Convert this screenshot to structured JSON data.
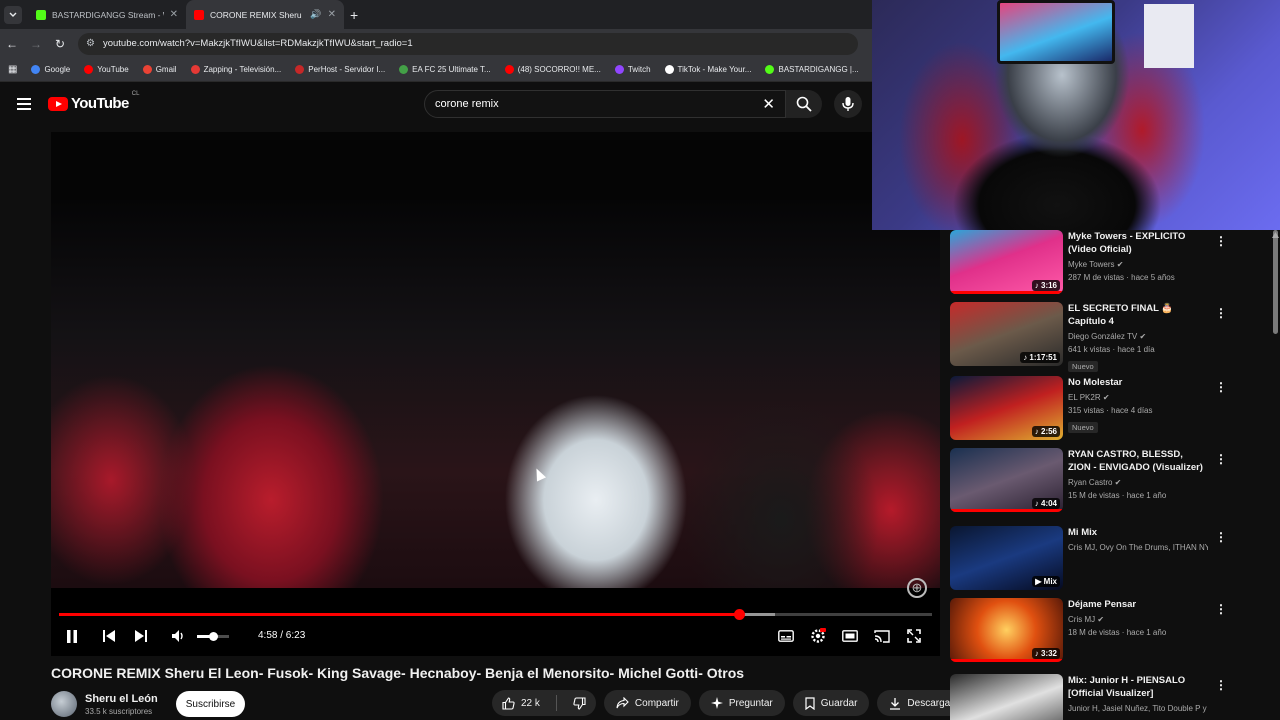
{
  "browser": {
    "tabs": [
      {
        "title": "BASTARDIGANGG Stream - Watch",
        "fav_color": "#53fc18",
        "active": false
      },
      {
        "title": "CORONE REMIX Sheru El Leon",
        "fav_color": "#ff0000",
        "active": true
      }
    ],
    "new_tab": "+",
    "url": "youtube.com/watch?v=MakzjkTfIWU&list=RDMakzjkTfIWU&start_radio=1",
    "bookmarks": [
      {
        "label": "Google",
        "color": "#4285f4"
      },
      {
        "label": "YouTube",
        "color": "#ff0000"
      },
      {
        "label": "Gmail",
        "color": "#ea4335"
      },
      {
        "label": "Zapping - Televisión...",
        "color": "#e53935"
      },
      {
        "label": "PerHost - Servidor I...",
        "color": "#c62828"
      },
      {
        "label": "EA FC 25 Ultimate T...",
        "color": "#43a047"
      },
      {
        "label": "(48) SOCORRO!! ME...",
        "color": "#ff0000"
      },
      {
        "label": "Twitch",
        "color": "#9146ff"
      },
      {
        "label": "TikTok - Make Your...",
        "color": "#ffffff"
      },
      {
        "label": "BASTARDIGANGG |...",
        "color": "#53fc18"
      }
    ]
  },
  "youtube": {
    "logo_text": "YouTube",
    "region": "CL",
    "search_query": "corone remix"
  },
  "player": {
    "time": "4:58 / 6:23",
    "progress": 0.779,
    "buffered": 0.82,
    "volume": 0.5
  },
  "video": {
    "title": "CORONE REMIX Sheru El Leon- Fusok- King Savage- Hecnaboy- Benja el Menorsito- Michel Gotti- Otros",
    "channel": "Sheru el León",
    "subscribers": "33.5 k suscriptores",
    "subscribe_label": "Suscribirse",
    "likes": "22 k",
    "share_label": "Compartir",
    "ask_label": "Preguntar",
    "save_label": "Guardar",
    "download_label": "Descargar"
  },
  "recommendations": [
    {
      "title": "Myke Towers - EXPLICITO (Video Oficial)",
      "channel": "Myke Towers",
      "stats": "287 M de vistas · hace 5 años",
      "duration": "3:16",
      "badge": "",
      "thumb": "linear-gradient(160deg,#2aa6d9 0%,#e0308a 45%,#ff5aa8 100%)",
      "watched": true
    },
    {
      "title": "EL SECRETO FINAL 🎂 Capítulo 4",
      "channel": "Diego González TV",
      "stats": "641 k vistas · hace 1 día",
      "duration": "1:17:51",
      "badge": "Nuevo",
      "thumb": "linear-gradient(160deg,#c62a2a 0%,#6b5a4a 50%,#2a2a2a 100%)",
      "watched": false
    },
    {
      "title": "No Molestar",
      "channel": "EL PK2R",
      "stats": "315 vistas · hace 4 días",
      "duration": "2:56",
      "badge": "Nuevo",
      "thumb": "linear-gradient(160deg,#0a1a3a 0%,#c02020 50%,#e0b030 100%)",
      "watched": false
    },
    {
      "title": "RYAN CASTRO, BLESSD, ZION - ENVIGADO (Visualizer)",
      "channel": "Ryan Castro",
      "stats": "15 M de vistas · hace 1 año",
      "duration": "4:04",
      "badge": "",
      "thumb": "linear-gradient(160deg,#1a3050 0%,#6a5a70 50%,#2a2030 100%)",
      "watched": true
    },
    {
      "title": "Mi Mix",
      "channel": "Cris MJ, Ovy On The Drums, ITHAN NY y ...",
      "stats": "",
      "duration": "Mix",
      "badge": "",
      "thumb": "linear-gradient(160deg,#0a1630 0%,#1a3a80 50%,#050a20 100%)",
      "watched": false
    },
    {
      "title": "Déjame Pensar",
      "channel": "Cris MJ",
      "stats": "18 M de vistas · hace 1 año",
      "duration": "3:32",
      "badge": "",
      "thumb": "radial-gradient(circle at 50% 50%,#ffd060 0%,#e05010 45%,#5a1a08 100%)",
      "watched": true
    },
    {
      "title": "Mix: Junior H - PIENSALO [Official Visualizer]",
      "channel": "Junior H, Jasiel Nuñez, Tito Double P y ...",
      "stats": "",
      "duration": "",
      "badge": "",
      "thumb": "linear-gradient(160deg,#2a2a2a 0%,#e0e0e0 50%,#3a3a3a 100%)",
      "watched": false
    }
  ]
}
